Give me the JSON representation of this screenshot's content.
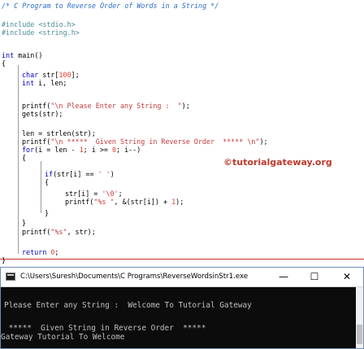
{
  "code": {
    "comment": "/* C Program to Reverse Order of Words in a String */",
    "include1_directive": "#include",
    "include1_header": "<stdio.h>",
    "include2_directive": "#include",
    "include2_header": "<string.h>",
    "main_kw": "int",
    "main_rest": " main()",
    "brace_open": "{",
    "decl1_kw": "char",
    "decl1_rest": " str[",
    "decl1_num": "100",
    "decl1_end": "];",
    "decl2_kw": "int",
    "decl2_rest": " i, len;",
    "printf1_a": "printf(",
    "printf1_str": "\"\\n Please Enter any String :  \"",
    "printf1_b": ");",
    "gets": "gets(str);",
    "len_line": "len = strlen(str);",
    "printf2_a": "printf(",
    "printf2_str": "\"\\n *****  Given String in Reverse Order  ***** \\n\"",
    "printf2_b": ");",
    "for_kw": "for",
    "for_a": "(i = len - ",
    "for_n1": "1",
    "for_b": "; i >= ",
    "for_n2": "0",
    "for_c": "; i--)",
    "for_brace": "{",
    "if_kw": "if",
    "if_a": "(str[i] == ",
    "if_str": "' '",
    "if_b": ")",
    "if_brace": "{",
    "assign_a": "str[i] = ",
    "assign_str": "'\\0'",
    "assign_b": ";",
    "printf3_a": "printf(",
    "printf3_str": "\"%s \"",
    "printf3_b": ", &(str[i]) + ",
    "printf3_n": "1",
    "printf3_c": ");",
    "if_close": "}",
    "for_close": "}",
    "printf4_a": "printf(",
    "printf4_str": "\"%s\"",
    "printf4_b": ", str);",
    "return_kw": "return",
    "return_n": "0",
    "return_end": ";",
    "brace_close": "}"
  },
  "watermark": "©tutorialgateway.org",
  "console_window": {
    "title": "C:\\Users\\Suresh\\Documents\\C Programs\\ReverseWordsinStr1.exe",
    "minimize_glyph": "—",
    "maximize_glyph": "☐",
    "close_glyph": "✕",
    "icon": "console-app-icon",
    "lines": [
      "Please Enter any String :  Welcome To Tutorial Gateway",
      " *****  Given String in Reverse Order  *****",
      "Gateway Tutorial To Welcome"
    ]
  },
  "colors": {
    "comment": "#2a6cc9",
    "keyword": "#0000c0",
    "string": "#c43a3a",
    "number": "#e0402c",
    "watermark": "#c0392b",
    "console_bg": "#0c0c0c",
    "console_text": "#c0c0c0"
  }
}
